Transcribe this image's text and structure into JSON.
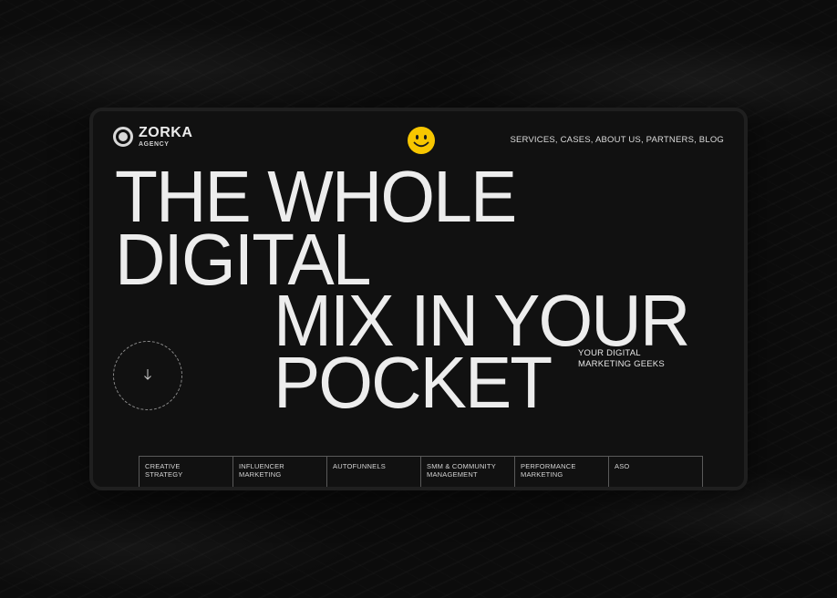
{
  "brand": {
    "name": "ZORKA",
    "subtitle": "AGENCY"
  },
  "nav": {
    "items": [
      "SERVICES,",
      "CASES,",
      "ABOUT US,",
      "PARTNERS,",
      "BLOG"
    ]
  },
  "hero": {
    "line1": "THE WHOLE",
    "line2": "DIGITAL",
    "line3": "MIX IN YOUR",
    "line4": "POCKET",
    "tagline_line1": "YOUR DIGITAL",
    "tagline_line2": "MARKETING GEEKS"
  },
  "services": [
    "CREATIVE\nSTRATEGY",
    "INFLUENCER\nMARKETING",
    "AUTOFUNNELS",
    "SMM & COMMUNITY\nMANAGEMENT",
    "PERFORMANCE\nMARKETING",
    "ASO"
  ],
  "icons": {
    "smiley": "smiley-face-icon",
    "scroll": "arrow-down-icon",
    "logo": "logo-ring-icon"
  },
  "colors": {
    "background": "#0c0c0c",
    "window": "#111111",
    "text": "#ededed",
    "smiley": "#f7c600"
  }
}
